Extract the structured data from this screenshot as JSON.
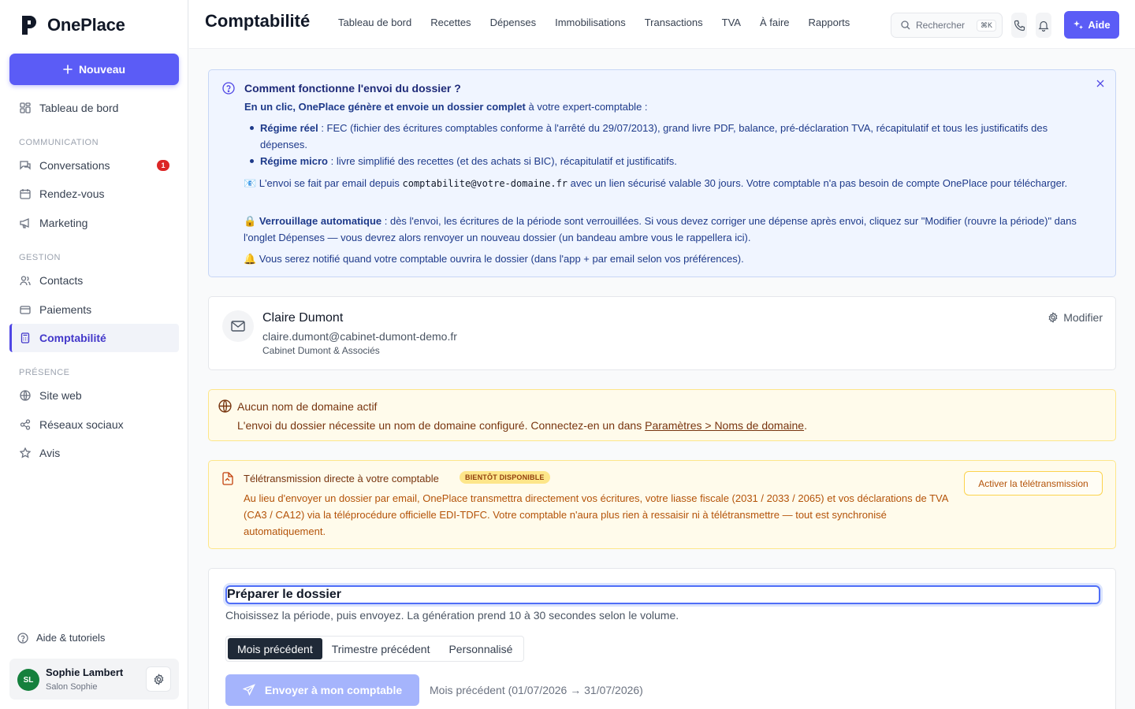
{
  "app": {
    "name": "OnePlace"
  },
  "sidebar": {
    "new_label": "Nouveau",
    "items_top": [
      {
        "label": "Tableau de bord",
        "icon": "dashboard-icon"
      }
    ],
    "sections": [
      {
        "title": "COMMUNICATION",
        "items": [
          {
            "label": "Conversations",
            "badge": "1"
          },
          {
            "label": "Rendez-vous"
          },
          {
            "label": "Marketing"
          }
        ]
      },
      {
        "title": "GESTION",
        "items": [
          {
            "label": "Contacts"
          },
          {
            "label": "Paiements"
          },
          {
            "label": "Comptabilité"
          }
        ]
      },
      {
        "title": "PRÉSENCE",
        "items": [
          {
            "label": "Site web"
          },
          {
            "label": "Réseaux sociaux"
          },
          {
            "label": "Avis"
          }
        ]
      }
    ],
    "help_label": "Aide & tutoriels",
    "user": {
      "initials": "SL",
      "name": "Sophie Lambert",
      "business": "Salon Sophie"
    }
  },
  "header": {
    "title": "Comptabilité",
    "tabs": [
      "Tableau de bord",
      "Recettes",
      "Dépenses",
      "Immobilisations",
      "Transactions",
      "TVA",
      "À faire",
      "Rapports"
    ],
    "search_placeholder": "Rechercher",
    "search_shortcut": "⌘K",
    "help_label": "Aide"
  },
  "info": {
    "title": "Comment fonctionne l'envoi du dossier ?",
    "intro_bold": "En un clic, OnePlace génère et envoie un dossier complet",
    "intro_rest": " à votre expert-comptable :",
    "reel_label": "Régime réel",
    "reel_text": " : FEC (fichier des écritures comptables conforme à l'arrêté du 29/07/2013), grand livre PDF, balance, pré-déclaration TVA, récapitulatif et tous les justificatifs des dépenses.",
    "micro_label": "Régime micro",
    "micro_text": " : livre simplifié des recettes (et des achats si BIC), récapitulatif et justificatifs.",
    "email_emoji": "📧",
    "email_pre": " L'envoi se fait par email depuis ",
    "email_code": "comptabilite@votre-domaine.fr",
    "email_post": " avec un lien sécurisé valable 30 jours. Votre comptable n'a pas besoin de compte OnePlace pour télécharger.",
    "lock_emoji": "🔒",
    "lock_label": "Verrouillage automatique",
    "lock_text": " : dès l'envoi, les écritures de la période sont verrouillées. Si vous devez corriger une dépense après envoi, cliquez sur \"Modifier (rouvre la période)\" dans l'onglet Dépenses — vous devrez alors renvoyer un nouveau dossier (un bandeau ambre vous le rappellera ici).",
    "bell_emoji": "🔔",
    "bell_text": " Vous serez notifié quand votre comptable ouvrira le dossier (dans l'app + par email selon vos préférences)."
  },
  "accountant": {
    "name": "Claire Dumont",
    "email": "claire.dumont@cabinet-dumont-demo.fr",
    "firm": "Cabinet Dumont & Associés",
    "edit_label": "Modifier"
  },
  "domain_warning": {
    "title": "Aucun nom de domaine actif",
    "text": "L'envoi du dossier nécessite un nom de domaine configuré. Connectez-en un dans ",
    "link": "Paramètres > Noms de domaine",
    "text_end": "."
  },
  "teletransmission": {
    "title": "Télétransmission directe à votre comptable",
    "badge": "BIENTÔT DISPONIBLE",
    "text": "Au lieu d'envoyer un dossier par email, OnePlace transmettra directement vos écritures, votre liasse fiscale (2031 / 2033 / 2065) et vos déclarations de TVA (CA3 / CA12) via la téléprocédure officielle EDI-TDFC. Votre comptable n'aura plus rien à ressaisir ni à télétransmettre — tout est synchronisé automatiquement.",
    "button": "Activer la télétransmission"
  },
  "prepare": {
    "title": "Préparer le dossier",
    "subtitle": "Choisissez la période, puis envoyez. La génération prend 10 à 30 secondes selon le volume.",
    "periods": [
      "Mois précédent",
      "Trimestre précédent",
      "Personnalisé"
    ],
    "selected_period": "Mois précédent",
    "send_label": "Envoyer à mon comptable",
    "period_summary": "Mois précédent (01/07/2026 → 31/07/2026)"
  },
  "colors": {
    "primary": "#5b5cf6",
    "info_bg": "#f0f5ff",
    "warning_bg": "#fffbeb",
    "badge_red": "#dc2626"
  }
}
